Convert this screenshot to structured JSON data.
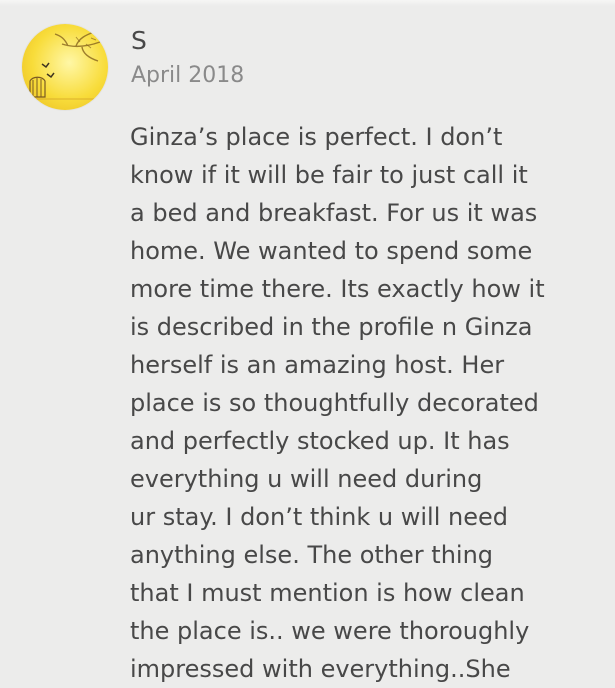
{
  "review": {
    "reviewer_name": "S",
    "date": "April 2018",
    "text": "Ginza’s place is perfect. I don’t\nknow if it will be fair to just call it\na bed and breakfast. For us it was\nhome. We wanted to spend some\nmore time there. Its exactly how it\nis described in the profile n Ginza\nherself is an amazing host. Her\nplace is so thoughtfully decorated\nand perfectly stocked up. It has\neverything u will need during\nur stay. I don’t think u will need\nanything else. The other thing\nthat I must mention is how clean\nthe place is.. we were thoroughly\nimpressed with everything..She"
  },
  "colors": {
    "background": "#ececeb",
    "text": "#484848",
    "secondary_text": "#8a8a8a",
    "avatar_yellow": "#f8dc3a"
  },
  "icons": {
    "avatar": "reviewer-profile-photo"
  }
}
